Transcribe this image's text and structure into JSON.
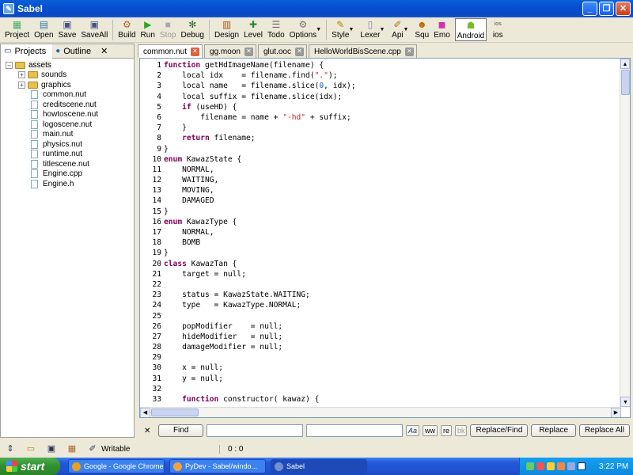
{
  "window": {
    "title": "Sabel"
  },
  "toolbar": {
    "items": [
      {
        "label": "Project",
        "icon": "project-icon"
      },
      {
        "label": "Open",
        "icon": "open-icon"
      },
      {
        "label": "Save",
        "icon": "save-icon"
      },
      {
        "label": "SaveAll",
        "icon": "save-all-icon"
      },
      {
        "label": "Build",
        "icon": "build-icon"
      },
      {
        "label": "Run",
        "icon": "run-icon"
      },
      {
        "label": "Stop",
        "icon": "stop-icon"
      },
      {
        "label": "Debug",
        "icon": "debug-icon"
      },
      {
        "label": "Design",
        "icon": "design-icon"
      },
      {
        "label": "Level",
        "icon": "level-icon"
      },
      {
        "label": "Todo",
        "icon": "todo-icon"
      },
      {
        "label": "Options",
        "icon": "options-icon"
      },
      {
        "label": "Style",
        "icon": "style-icon"
      },
      {
        "label": "Lexer",
        "icon": "lexer-icon"
      },
      {
        "label": "Api",
        "icon": "api-icon"
      },
      {
        "label": "Squ",
        "icon": "squ-icon"
      },
      {
        "label": "Emo",
        "icon": "emo-icon"
      },
      {
        "label": "Android",
        "icon": "android-icon"
      },
      {
        "label": "ios",
        "icon": "ios-icon"
      }
    ]
  },
  "left_panel": {
    "tabs": [
      {
        "label": "Projects"
      },
      {
        "label": "Outline"
      }
    ],
    "close_label": "✕",
    "tree": {
      "root": "assets",
      "folders": [
        "sounds",
        "graphics"
      ],
      "files": [
        "common.nut",
        "creditscene.nut",
        "howtoscene.nut",
        "logoscene.nut",
        "main.nut",
        "physics.nut",
        "runtime.nut",
        "titlescene.nut",
        "Engine.cpp",
        "Engine.h"
      ]
    }
  },
  "editor": {
    "tabs": [
      "common.nut",
      "gg.moon",
      "glut.ooc",
      "HelloWorldBisScene.cpp"
    ],
    "code": [
      "function getHdImageName(filename) {",
      "    local idx    = filename.find(\".\");",
      "    local name   = filename.slice(0, idx);",
      "    local suffix = filename.slice(idx);",
      "    if (useHD) {",
      "        filename = name + \"-hd\" + suffix;",
      "    }",
      "    return filename;",
      "}",
      "enum KawazState {",
      "    NORMAL,",
      "    WAITING,",
      "    MOVING,",
      "    DAMAGED",
      "}",
      "enum KawazType {",
      "    NORMAL,",
      "    BOMB",
      "}",
      "class KawazTan {",
      "    target = null;",
      "",
      "    status = KawazState.WAITING;",
      "    type   = KawazType.NORMAL;",
      "",
      "    popModifier    = null;",
      "    hideModifier   = null;",
      "    damageModifier = null;",
      "",
      "    x = null;",
      "    y = null;",
      "",
      "    function constructor( kawaz) {"
    ]
  },
  "find_bar": {
    "close_label": "✕",
    "find_label": "Find",
    "find_value": "",
    "replace_value": "",
    "toggles": [
      "Aa",
      "ww",
      "re",
      "bk"
    ],
    "replace_find_label": "Replace/Find",
    "replace_label": "Replace",
    "replace_all_label": "Replace All"
  },
  "status_bar": {
    "mode": "Writable",
    "position": "0 : 0"
  },
  "taskbar": {
    "start_label": "start",
    "items": [
      {
        "label": "Google - Google Chrome",
        "color": "#e8a020"
      },
      {
        "label": "PyDev - Sabel/windo...",
        "color": "#f0a040"
      },
      {
        "label": "Sabel",
        "color": "#7090d0"
      }
    ],
    "clock": "3:22 PM"
  }
}
